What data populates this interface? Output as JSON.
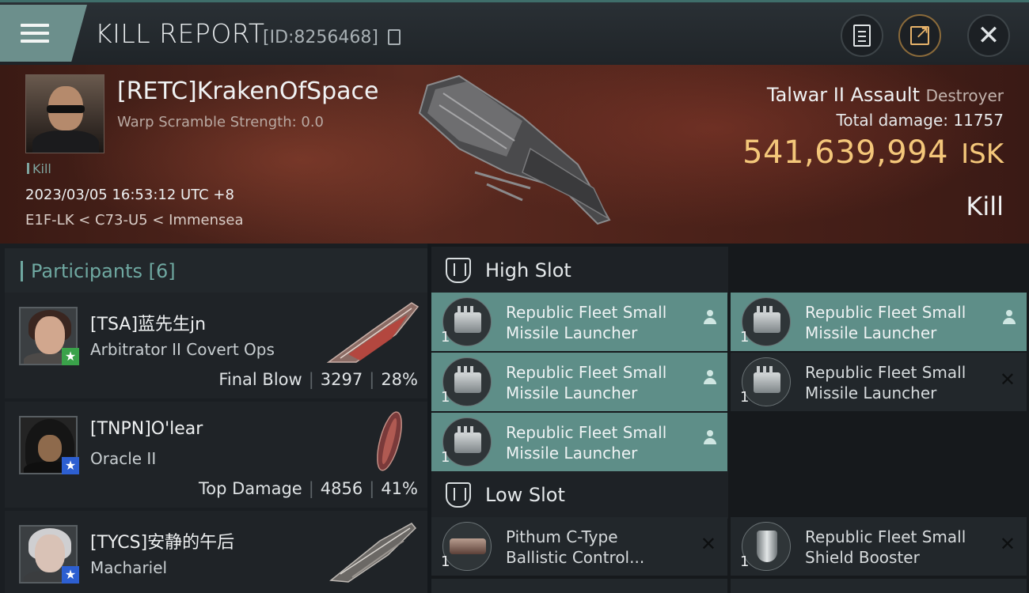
{
  "header": {
    "title": "KILL REPORT",
    "report_id": "[ID:8256468]"
  },
  "victim": {
    "pilot": "[RETC]KrakenOfSpace",
    "scramble": "Warp Scramble Strength: 0.0",
    "tag": "Kill",
    "datetime": "2023/03/05 16:53:12 UTC +8",
    "location": "E1F-LK < C73-U5 < Immensea",
    "ship_name": "Talwar II Assault",
    "ship_class": "Destroyer",
    "total_damage_label": "Total damage:",
    "total_damage": "11757",
    "isk_value": "541,639,994",
    "isk_unit": "ISK",
    "result": "Kill"
  },
  "participants": {
    "label": "Participants [6]",
    "rows": [
      {
        "name": "[TSA]蓝先生jn",
        "ship": "Arbitrator II Covert Ops",
        "role": "Final Blow",
        "damage": "3297",
        "percent": "28%"
      },
      {
        "name": "[TNPN]O'lear",
        "ship": "Oracle II",
        "role": "Top Damage",
        "damage": "4856",
        "percent": "41%"
      },
      {
        "name": "[TYCS]安静的午后",
        "ship": "Machariel"
      }
    ]
  },
  "fitting": {
    "high_slot_label": "High Slot",
    "low_slot_label": "Low Slot",
    "high": [
      {
        "qty": "1",
        "line1": "Republic Fleet Small",
        "line2": "Missile Launcher",
        "status": "online"
      },
      {
        "qty": "1",
        "line1": "Republic Fleet Small",
        "line2": "Missile Launcher",
        "status": "online"
      },
      {
        "qty": "1",
        "line1": "Republic Fleet Small",
        "line2": "Missile Launcher",
        "status": "online"
      },
      {
        "qty": "1",
        "line1": "Republic Fleet Small",
        "line2": "Missile Launcher",
        "status": "destroyed"
      },
      {
        "qty": "1",
        "line1": "Republic Fleet Small",
        "line2": "Missile Launcher",
        "status": "online"
      }
    ],
    "low": [
      {
        "qty": "1",
        "line1": "Pithum C-Type",
        "line2": "Ballistic Control...",
        "status": "destroyed"
      },
      {
        "qty": "1",
        "line1": "Republic Fleet Small",
        "line2": "Shield Booster",
        "status": "destroyed"
      }
    ]
  },
  "colors": {
    "accent": "#6fa8a1",
    "isk_gold": "#f4c77a",
    "module_active": "#5e8e88",
    "banner_red": "#5a2a20"
  },
  "icons": {
    "menu": "menu-icon",
    "copy": "copy-icon",
    "clipboard": "clipboard-icon",
    "share": "share-icon",
    "close": "close-icon",
    "slot": "slot-icon",
    "online": "person-icon",
    "destroyed": "x-icon"
  }
}
